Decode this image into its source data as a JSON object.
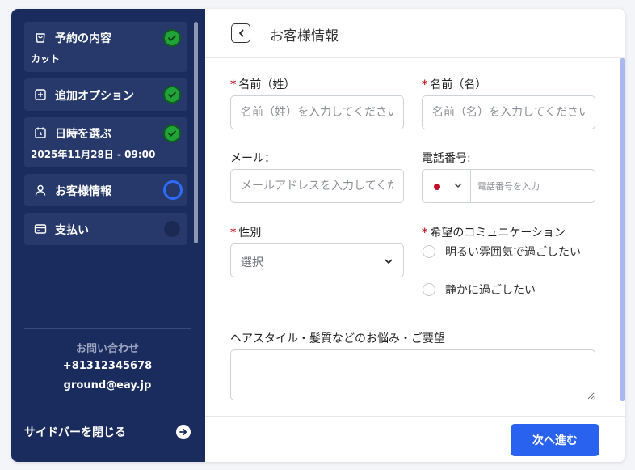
{
  "sidebar": {
    "steps": [
      {
        "label": "予約の内容",
        "sub": "カット",
        "icon": "shopping-bag-icon",
        "status": "done"
      },
      {
        "label": "追加オプション",
        "sub": "",
        "icon": "plus-square-icon",
        "status": "done"
      },
      {
        "label": "日時を選ぶ",
        "sub": "2025年11月28日 - 09:00",
        "icon": "calendar-clock-icon",
        "status": "done"
      },
      {
        "label": "お客様情報",
        "sub": "",
        "icon": "user-icon",
        "status": "current"
      },
      {
        "label": "支払い",
        "sub": "",
        "icon": "credit-card-icon",
        "status": "pending"
      }
    ],
    "contact": {
      "title": "お問い合わせ",
      "phone": "+81312345678",
      "email": "ground@eay.jp"
    },
    "close_label": "サイドバーを閉じる"
  },
  "header": {
    "title": "お客様情報"
  },
  "form": {
    "last_name": {
      "label": "名前（姓）",
      "placeholder": "名前（姓）を入力してください",
      "required": true
    },
    "first_name": {
      "label": "名前（名）",
      "placeholder": "名前（名）を入力してください",
      "required": true
    },
    "email": {
      "label": "メール：",
      "placeholder": "メールアドレスを入力してください",
      "required": false
    },
    "phone": {
      "label": "電話番号:",
      "placeholder": "電話番号を入力",
      "required": false
    },
    "gender": {
      "label": "性別",
      "value": "選択",
      "required": true
    },
    "communication": {
      "label": "希望のコミュニケーション",
      "required": true,
      "options": [
        "明るい雰囲気で過ごしたい",
        "静かに過ごしたい"
      ]
    },
    "concerns": {
      "label": "ヘアスタイル・髪質などのお悩み・ご要望",
      "value": ""
    }
  },
  "footer": {
    "next_label": "次へ進む"
  },
  "required_mark": "*",
  "colors": {
    "sidebar_bg": "#1a2b5e",
    "step_bg": "#27396b",
    "done": "#22a33a",
    "current": "#2d6bff",
    "required": "#c0202a",
    "primary_button": "#2a62f0"
  }
}
